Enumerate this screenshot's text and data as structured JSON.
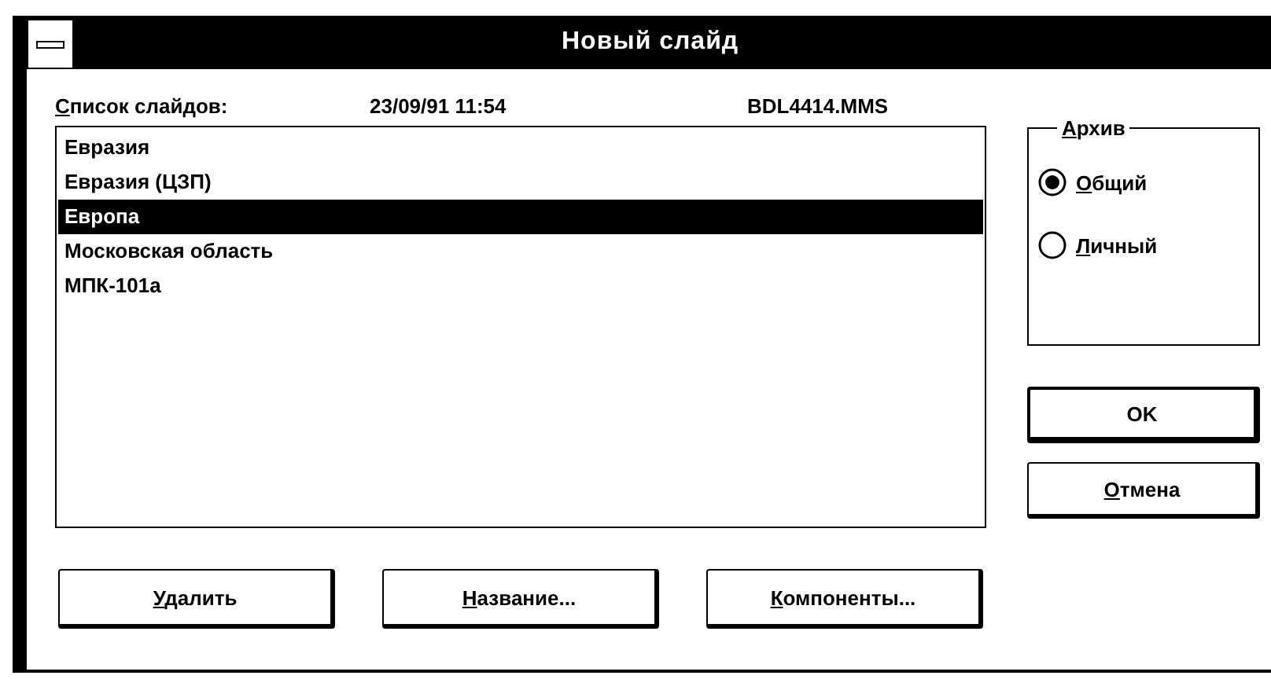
{
  "window": {
    "title": "Новый слайд"
  },
  "header": {
    "label": "Список слайдов:",
    "mnemonic": true,
    "date": "23/09/91 11:54",
    "file": "BDL4414.MMS"
  },
  "slides": [
    {
      "name": "Евразия",
      "selected": false
    },
    {
      "name": "Евразия (ЦЗП)",
      "selected": false
    },
    {
      "name": "Европа",
      "selected": true
    },
    {
      "name": "Московская область",
      "selected": false
    },
    {
      "name": "МПК-101а",
      "selected": false
    }
  ],
  "archive": {
    "title": "Архив",
    "mnemonic": true,
    "options": [
      {
        "label": "Общий",
        "mnemonic": true,
        "selected": true
      },
      {
        "label": "Личный",
        "mnemonic": true,
        "selected": false
      }
    ]
  },
  "side_buttons": [
    {
      "label": "OK",
      "mnemonic": false,
      "default": true
    },
    {
      "label": "Отмена",
      "mnemonic": true,
      "default": false
    }
  ],
  "bottom_buttons": [
    {
      "label": "Удалить",
      "mnemonic": true
    },
    {
      "label": "Название...",
      "mnemonic": true
    },
    {
      "label": "Компоненты...",
      "mnemonic": true
    }
  ]
}
